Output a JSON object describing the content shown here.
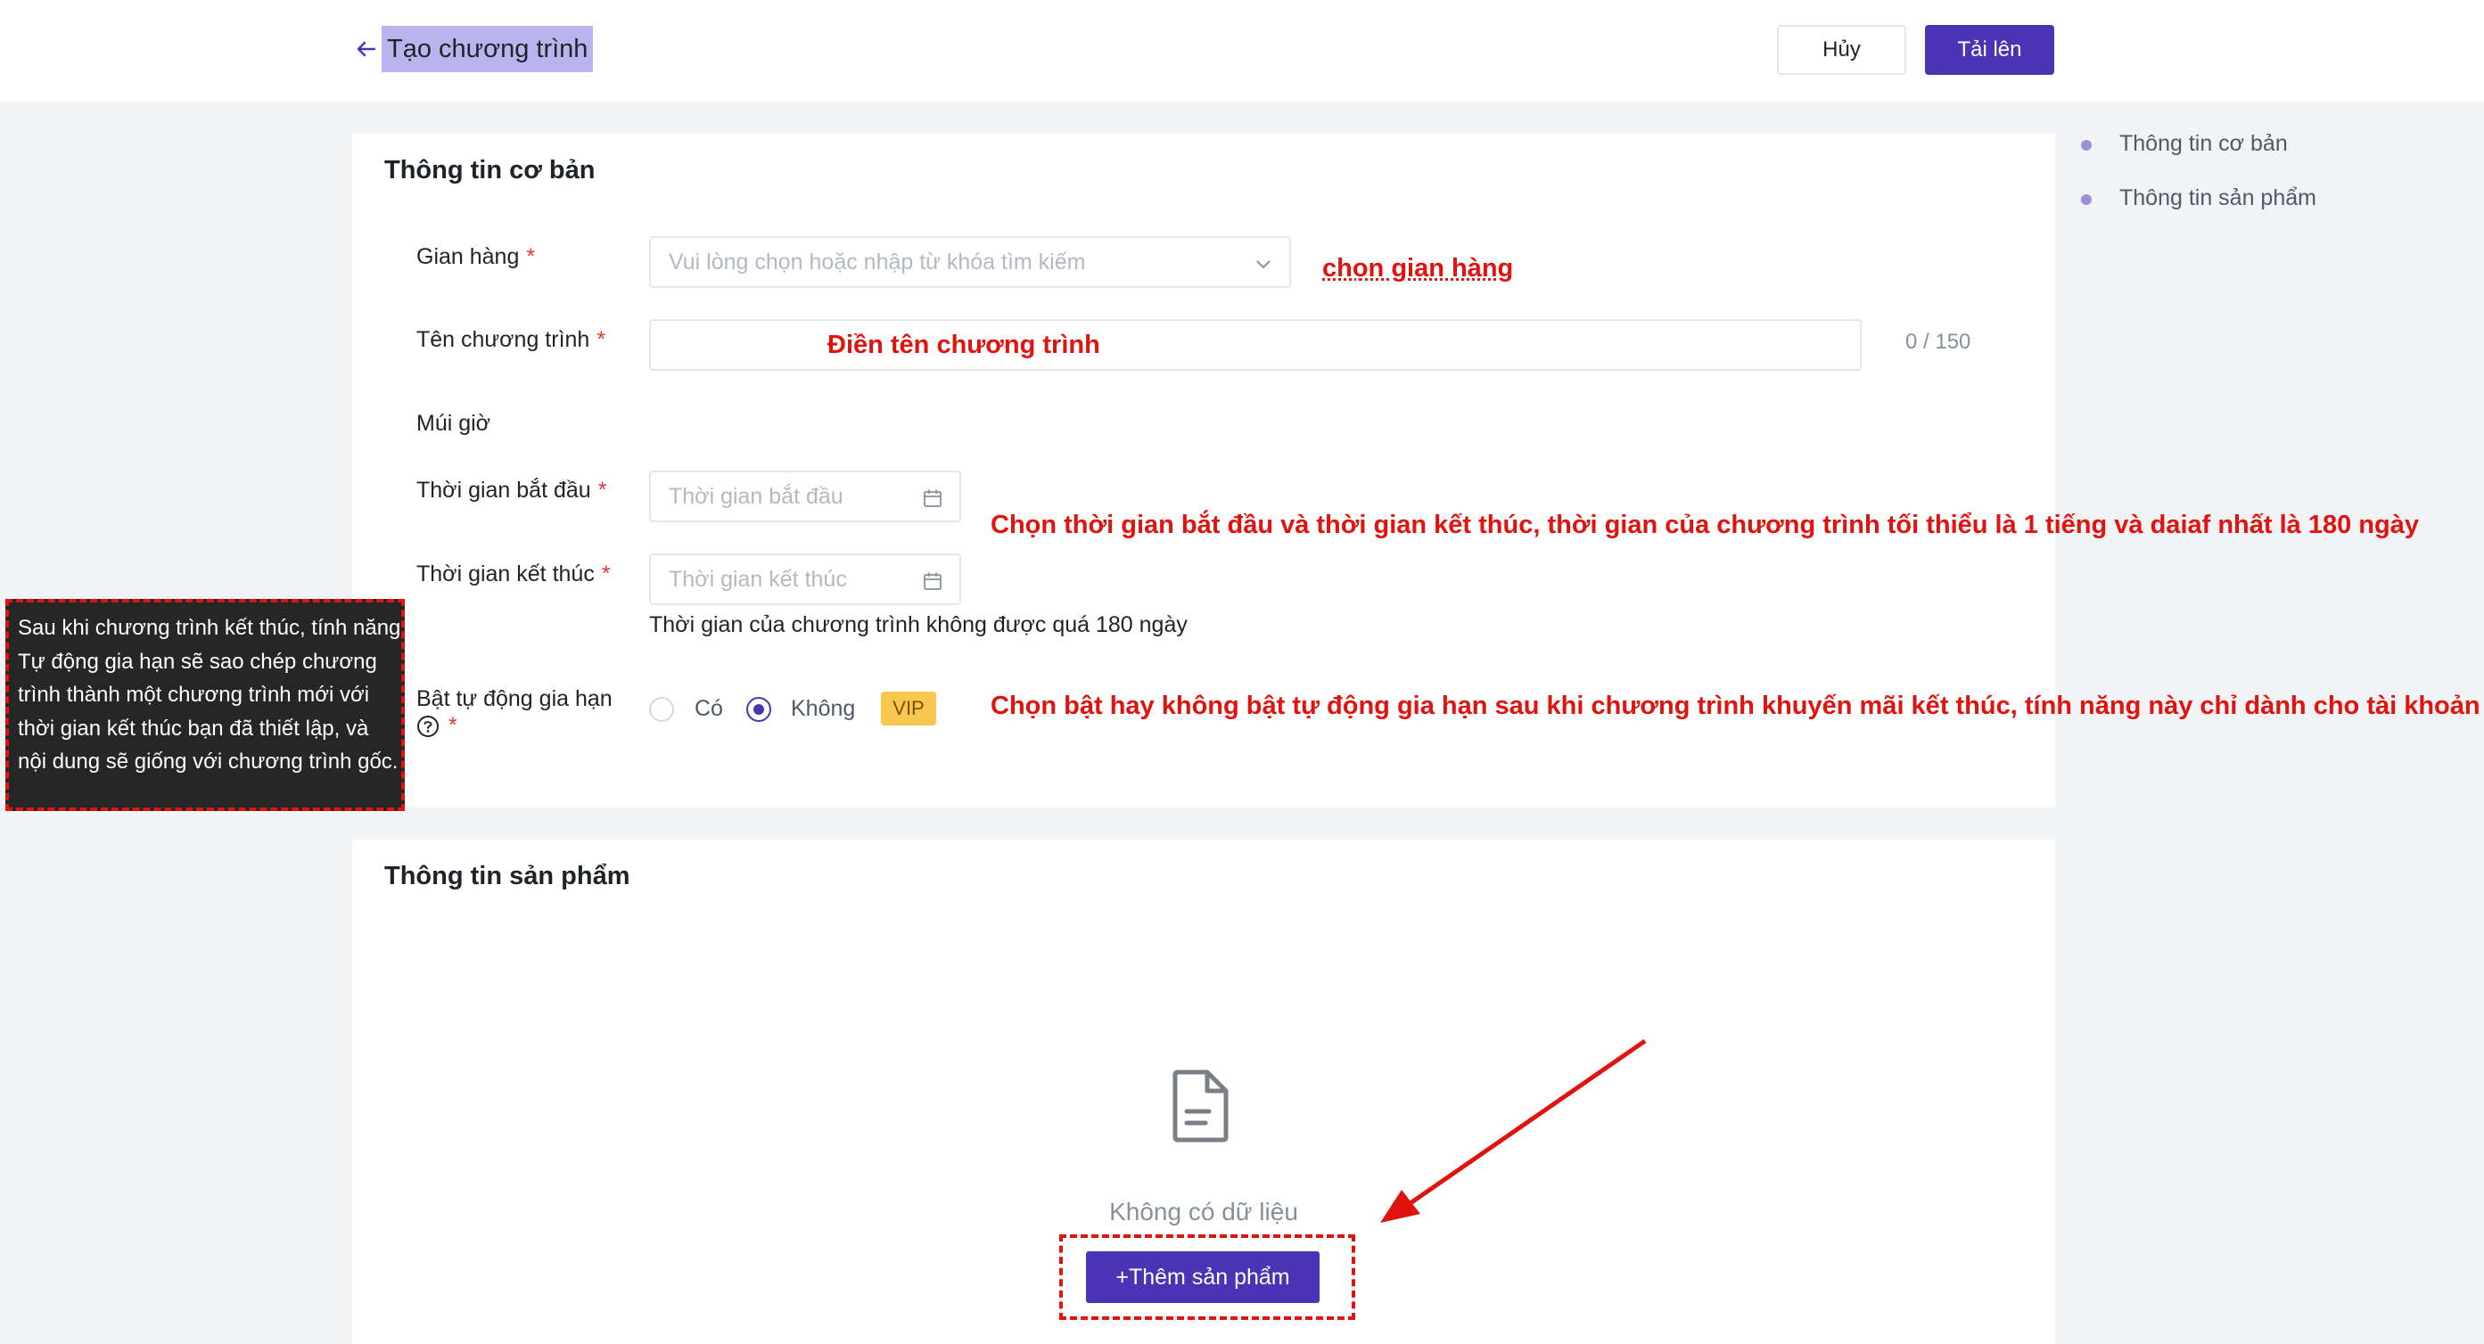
{
  "header": {
    "title": "Tạo chương trình",
    "cancel_label": "Hủy",
    "upload_label": "Tải lên"
  },
  "anchor_nav": {
    "items": [
      "Thông tin cơ bản",
      "Thông tin sản phẩm"
    ]
  },
  "basic_info": {
    "title": "Thông tin cơ bản",
    "shop": {
      "label": "Gian hàng",
      "required": "*",
      "placeholder": "Vui lòng chọn hoặc nhập từ khóa tìm kiếm"
    },
    "program_name": {
      "label": "Tên chương trình",
      "required": "*",
      "counter": "0 / 150"
    },
    "timezone": {
      "label": "Múi giờ"
    },
    "start_time": {
      "label": "Thời gian bắt đầu",
      "required": "*",
      "placeholder": "Thời gian bắt đầu"
    },
    "end_time": {
      "label": "Thời gian kết thúc",
      "required": "*",
      "placeholder": "Thời gian kết thúc",
      "hint": "Thời gian của chương trình không được quá 180 ngày"
    },
    "auto_renew": {
      "label": "Bật tự động gia hạn",
      "required": "*",
      "option_yes": "Có",
      "option_no": "Không",
      "selected": "Không",
      "vip_badge": "VIP"
    }
  },
  "product_info": {
    "title": "Thông tin sản phẩm",
    "empty_text": "Không có dữ liệu",
    "add_button": "+Thêm sản phẩm"
  },
  "tooltip": {
    "text": "Sau khi chương trình kết thúc, tính năng Tự động gia hạn sẽ sao chép chương trình thành một chương trình mới với thời gian kết thúc bạn đã thiết lập, và nội dung sẽ giống với chương trình gốc."
  },
  "annotations": {
    "shop": "chọn gian hàng",
    "program_name": "Điền tên chương trình",
    "time": "Chọn thời gian bắt đầu và thời gian kết thúc, thời gian của chương trình tối thiểu là 1 tiếng và daiaf nhất là 180 ngày",
    "auto_renew": "Chọn bật hay không bật tự động gia hạn sau khi chương trình khuyến mãi kết thúc, tính năng này chỉ dành cho tài khoản VIP"
  },
  "colors": {
    "primary": "#4a33b4",
    "annotation_red": "#e0130f",
    "title_highlight": "#b9b3ee",
    "vip": "#f9c74f"
  },
  "icons": [
    "back-arrow-icon",
    "chevron-down-icon",
    "calendar-icon",
    "help-circle-icon",
    "document-icon"
  ]
}
